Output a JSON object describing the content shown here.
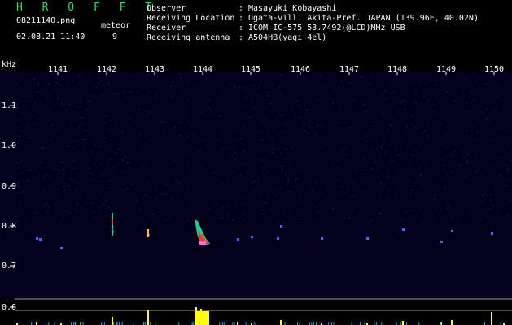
{
  "header": {
    "title": "H R O F F T",
    "filename": "08211140.png",
    "datetime": "02.08.21 11:40",
    "meteor_label": "meteor",
    "meteor_count": "9"
  },
  "info": [
    {
      "label": "Observer",
      "sep": ":",
      "value": "Masayuki Kobayashi"
    },
    {
      "label": "Receiving Location",
      "sep": ":",
      "value": "Ogata-vill. Akita-Pref. JAPAN (139.96E, 40.02N)"
    },
    {
      "label": "Receiver",
      "sep": ":",
      "value": "ICOM IC-575 53.7492(@LCD)MHz USB"
    },
    {
      "label": "Receiving antenna",
      "sep": ":",
      "value": "A504HB(yagi 4el)"
    }
  ],
  "axis": {
    "unit": "kHz",
    "freq_labels": [
      "1.1",
      "1.0",
      "0.9",
      "0.8",
      "0.7",
      "0.6"
    ],
    "minute_labels": [
      "1141",
      "1142",
      "1143",
      "1144",
      "1145",
      "1146",
      "1147",
      "1148",
      "1149",
      "1150"
    ]
  },
  "colors": {
    "title": "#33dd55",
    "noise": "#1a1a6e",
    "meteor_hot": "#ff3333",
    "meteor_mid": "#22cc88",
    "activity": "#ffff00"
  }
}
